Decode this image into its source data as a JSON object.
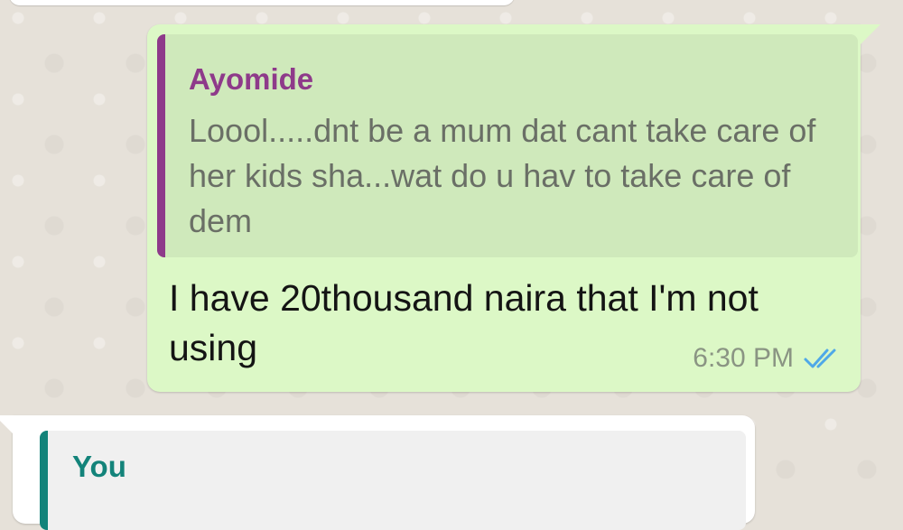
{
  "chat": {
    "outgoing_message": {
      "quoted": {
        "author": "Ayomide",
        "text": "Loool.....dnt be a mum dat cant take care of her kids sha...wat do u hav to take care of dem"
      },
      "text": "I have 20thousand naira that I'm not using",
      "time": "6:30 PM",
      "status_icon": "double-check-read-icon"
    },
    "incoming_message": {
      "quoted": {
        "author": "You"
      }
    }
  },
  "colors": {
    "outgoing_bubble": "#dcf8c6",
    "quoted_author_ayomide": "#8e3a8a",
    "quoted_bar_ayomide": "#8e3a8a",
    "quoted_author_you": "#13837a",
    "quoted_bar_you": "#13837a",
    "read_ticks": "#4fa8e8"
  }
}
